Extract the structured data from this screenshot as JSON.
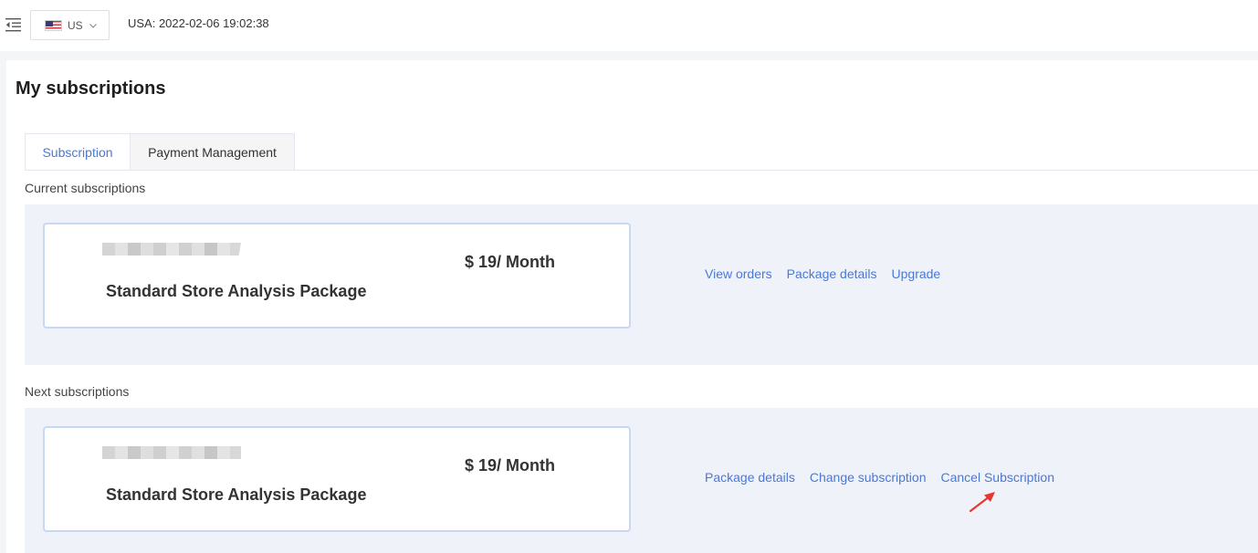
{
  "header": {
    "menu_icon": "menu-fold-icon",
    "region": {
      "flag_icon": "us-flag-icon",
      "label": "US",
      "chevron_icon": "chevron-down-icon"
    },
    "clock_text": "USA: 2022-02-06 19:02:38"
  },
  "page": {
    "title": "My subscriptions",
    "tabs": [
      {
        "label": "Subscription",
        "active": true
      },
      {
        "label": "Payment Management",
        "active": false
      }
    ]
  },
  "current": {
    "label": "Current subscriptions",
    "price": "$ 19/ Month",
    "package_name": "Standard Store Analysis Package",
    "actions": [
      "View orders",
      "Package details",
      "Upgrade"
    ]
  },
  "next": {
    "label": "Next subscriptions",
    "price": "$ 19/ Month",
    "package_name": "Standard Store Analysis Package",
    "actions": [
      "Package details",
      "Change subscription",
      "Cancel Subscription"
    ]
  },
  "colors": {
    "link": "#4a78d6",
    "card_border": "#c8d8f3",
    "block_bg": "#f0f2fa",
    "annotation_arrow": "#e8372f"
  }
}
